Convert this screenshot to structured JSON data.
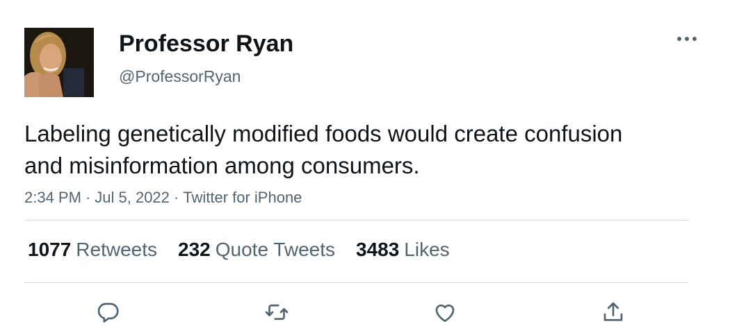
{
  "tweet": {
    "author": {
      "display_name": "Professor Ryan",
      "handle": "@ProfessorRyan"
    },
    "text": "Labeling genetically modified foods would create confusion and misinformation among consumers.",
    "meta": {
      "time": "2:34 PM",
      "date": "Jul 5, 2022",
      "source": "Twitter for iPhone",
      "separator": "·"
    },
    "stats": {
      "retweets_count": "1077",
      "retweets_label": "Retweets",
      "quotes_count": "232",
      "quotes_label": "Quote Tweets",
      "likes_count": "3483",
      "likes_label": "Likes"
    },
    "actions": [
      "reply-icon",
      "retweet-icon",
      "like-icon",
      "share-icon"
    ],
    "more_icon": "more-icon"
  },
  "colors": {
    "text_primary": "#0f1419",
    "text_secondary": "#536471",
    "divider": "#cfd9de",
    "background": "#ffffff"
  }
}
